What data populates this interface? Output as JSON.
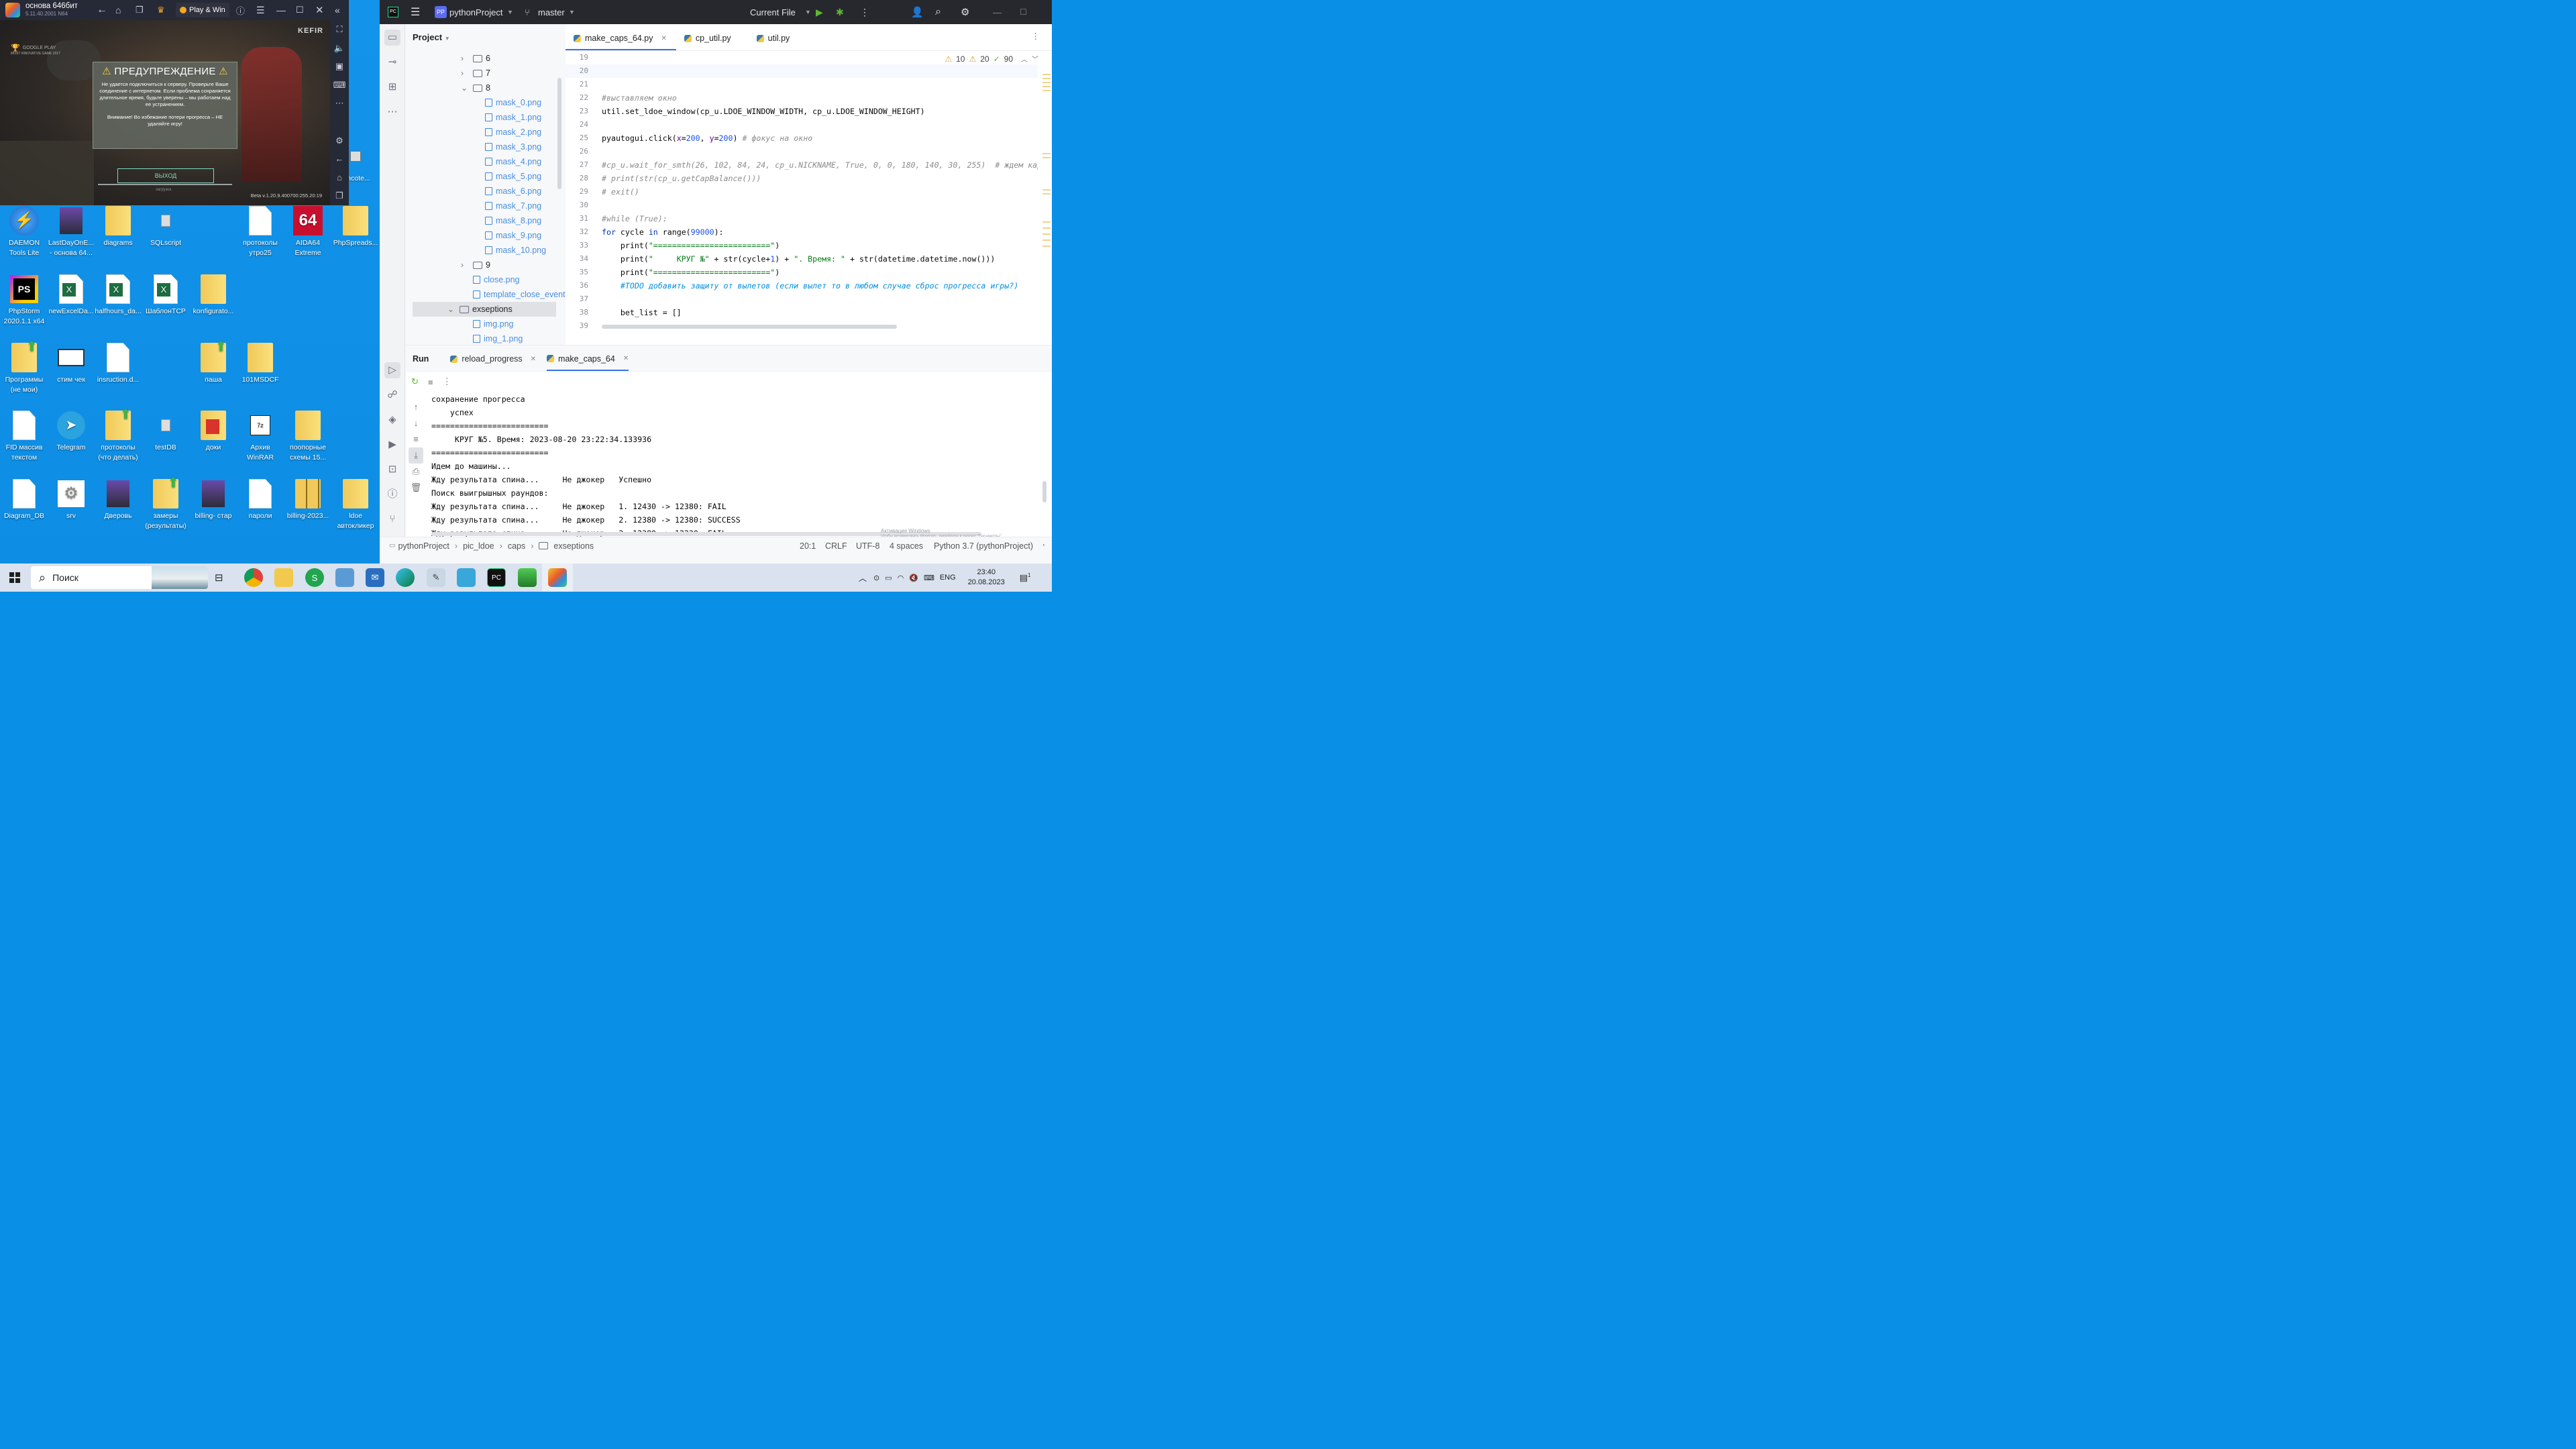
{
  "emulator": {
    "title": "основа 646бит",
    "version": "5.11.40.2001 N64",
    "play_win": "Play & Win",
    "publisher": "KEFIR",
    "badge": "GOOGLE PLAY",
    "badge_sub": "MOST INNOVATIVE GAME 2017",
    "warning_title": "ПРЕДУПРЕЖДЕНИЕ",
    "warning_text": "Не удается подключиться к серверу. Проверьте Ваше соединение с интернетом. Если проблема сохраняется длительное время, будьте уверены – мы работаем над ее устранением.",
    "warning_text2": "Внимание! Во избежание потери прогресса – НЕ удаляйте игру!",
    "exit_button": "ВЫХОД",
    "loading": "загрузка",
    "build": "Beta v.1.20.9.400700:255.20:19"
  },
  "desktop_icons": [
    {
      "label": "DAEMON Tools Lite"
    },
    {
      "label": "LastDayOnE... - основа 64..."
    },
    {
      "label": "diagrams"
    },
    {
      "label": "SQLscript"
    },
    {
      "label": "протоколы утро25"
    },
    {
      "label": "AIDA64 Extreme"
    },
    {
      "label": "PhpSpreads..."
    },
    {
      "label": "PhpStorm 2020.1.1 x64"
    },
    {
      "label": "newExcelDa..."
    },
    {
      "label": "halfhours_da..."
    },
    {
      "label": "ШаблонTCP"
    },
    {
      "label": "konfigurato..."
    },
    {
      "label": "Программы (не мои)"
    },
    {
      "label": "стим чек"
    },
    {
      "label": "insruction.d..."
    },
    {
      "label": "паша"
    },
    {
      "label": "101MSDCF"
    },
    {
      "label": "FID массив текстом"
    },
    {
      "label": "Telegram"
    },
    {
      "label": "протоколы (что делать)"
    },
    {
      "label": "testDB"
    },
    {
      "label": "доки"
    },
    {
      "label": "Архив WinRAR"
    },
    {
      "label": "поопорные схемы 15..."
    },
    {
      "label": "Diagram_DB"
    },
    {
      "label": "srv"
    },
    {
      "label": "Дверовь"
    },
    {
      "label": "замеры (результаты)"
    },
    {
      "label": "billing- стар"
    },
    {
      "label": "пароли"
    },
    {
      "label": "billing-2023..."
    },
    {
      "label": "ldoe автокликер"
    },
    {
      "label": "pIncote..."
    }
  ],
  "ide": {
    "logo": "PP",
    "project": "pythonProject",
    "branch": "master",
    "run_config": "Current File",
    "project_label": "Project",
    "tree": [
      "6",
      "7",
      "8",
      "mask_0.png",
      "mask_1.png",
      "mask_2.png",
      "mask_3.png",
      "mask_4.png",
      "mask_5.png",
      "mask_6.png",
      "mask_7.png",
      "mask_8.png",
      "mask_9.png",
      "mask_10.png",
      "9",
      "close.png",
      "template_close_event",
      "exseptions",
      "img.png",
      "img_1.png"
    ],
    "tabs": [
      "make_caps_64.py",
      "cp_util.py",
      "util.py"
    ],
    "inspections": {
      "warnings": "10",
      "weak": "20",
      "ok": "90"
    },
    "line_numbers": [
      "19",
      "20",
      "21",
      "22",
      "23",
      "24",
      "25",
      "26",
      "27",
      "28",
      "29",
      "30",
      "31",
      "32",
      "33",
      "34",
      "35",
      "36",
      "37",
      "38",
      "39"
    ],
    "run_label": "Run",
    "run_tabs": [
      "reload_progress",
      "make_caps_64"
    ],
    "output": [
      "сохранение прогресса",
      "    успех",
      "=========================",
      "     КРУГ №5. Время: 2023-08-20 23:22:34.133936",
      "=========================",
      "Идем до машины...",
      "Жду результата спина...     Не джокер   Успешно",
      "Поиск выигрышных раундов:",
      "Жду результата спина...     Не джокер   1. 12430 -> 12380: FAIL",
      "Жду результата спина...     Не джокер   2. 12380 -> 12380: SUCCESS",
      "Жду результата спина...     Не джокер   3. 12380 -> 12330: FAIL"
    ],
    "breadcrumbs": [
      "pythonProject",
      "pic_ldoe",
      "caps",
      "exseptions"
    ],
    "status": {
      "pos": "20:1",
      "eol": "CRLF",
      "enc": "UTF-8",
      "indent": "4 spaces",
      "interp": "Python 3.7 (pythonProject)"
    },
    "activation": "Активация Windows",
    "activation_sub": "Чтобы активировать Windows, перейдите в раздел \"Параметры\"."
  },
  "taskbar": {
    "search": "Поиск",
    "lang": "ENG",
    "time": "23:40",
    "date": "20.08.2023",
    "notif": "1"
  },
  "colors": {
    "desktop": "#0d8de3",
    "ide_dark": "#27282e",
    "accent": "#3574f0",
    "png_link": "#4a8fe0"
  }
}
